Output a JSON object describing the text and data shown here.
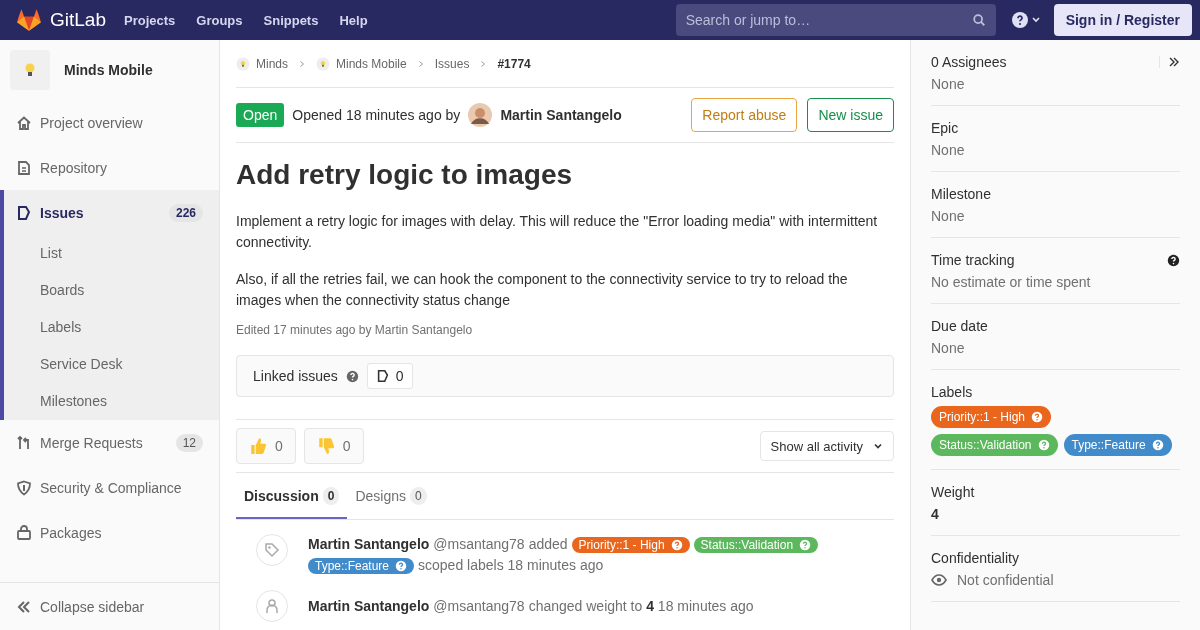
{
  "navbar": {
    "brand": "GitLab",
    "links": [
      "Projects",
      "Groups",
      "Snippets",
      "Help"
    ],
    "search": {
      "placeholder": "Search or jump to…"
    },
    "sign_in": "Sign in / Register"
  },
  "project": {
    "name": "Minds Mobile"
  },
  "nav_items": [
    {
      "label": "Project overview",
      "selected": false
    },
    {
      "label": "Repository",
      "selected": false
    },
    {
      "label": "Issues",
      "count": "226",
      "selected": true,
      "children": [
        {
          "label": "List"
        },
        {
          "label": "Boards"
        },
        {
          "label": "Labels"
        },
        {
          "label": "Service Desk"
        },
        {
          "label": "Milestones"
        }
      ]
    },
    {
      "label": "Merge Requests",
      "count": "12",
      "selected": false
    },
    {
      "label": "Security & Compliance",
      "selected": false
    },
    {
      "label": "Packages",
      "selected": false
    }
  ],
  "collapse": "Collapse sidebar",
  "breadcrumbs": [
    {
      "label": "Minds",
      "kind": "project"
    },
    {
      "label": "Minds Mobile",
      "kind": "project"
    },
    {
      "label": "Issues",
      "kind": "plain"
    },
    {
      "label": "#1774",
      "kind": "current"
    }
  ],
  "issue": {
    "status": "Open",
    "opened": "Opened 18 minutes ago by",
    "author": "Martin Santangelo",
    "actions": [
      {
        "label": "Report abuse",
        "kind": "warning"
      },
      {
        "label": "New issue",
        "kind": "success"
      }
    ],
    "title": "Add retry logic to images",
    "paragraphs": [
      "Implement a retry logic for images with delay. This will reduce the \"Error loading media\" with intermittent connectivity.",
      "Also, if all the retries fail, we can hook the component to the connectivity service to try to reload the images when the connectivity status change"
    ],
    "edited": "Edited 17 minutes ago by Martin Santangelo"
  },
  "linked_issues": {
    "label": "Linked issues",
    "count": "0"
  },
  "reactions": [
    {
      "kind": "thumbsup",
      "count": "0"
    },
    {
      "kind": "thumbsdown",
      "count": "0"
    }
  ],
  "activity_filter": "Show all activity",
  "tabs": [
    {
      "label": "Discussion",
      "count": "0",
      "selected": true
    },
    {
      "label": "Designs",
      "count": "0",
      "selected": false
    }
  ],
  "activity": [
    {
      "kind": "labels",
      "author": "Martin Santangelo",
      "handle": "@msantang78",
      "action": "added",
      "labels": [
        {
          "text": "Priority::1 - High",
          "color": "#e9661c"
        },
        {
          "text": "Status::Validation",
          "color": "#5cb85c"
        },
        {
          "text": "Type::Feature",
          "color": "#428bca"
        }
      ],
      "suffix": "scoped labels 18 minutes ago"
    },
    {
      "kind": "text",
      "author": "Martin Santangelo",
      "handle": "@msantang78",
      "action": "changed weight to **4** 18 minutes ago"
    }
  ],
  "sidebar": [
    {
      "kind": "text",
      "title": "0 Assignees",
      "value": "None"
    },
    {
      "kind": "text",
      "title": "Epic",
      "value": "None"
    },
    {
      "kind": "text",
      "title": "Milestone",
      "value": "None"
    },
    {
      "kind": "help",
      "title": "Time tracking",
      "value": "No estimate or time spent"
    },
    {
      "kind": "text",
      "title": "Due date",
      "value": "None"
    },
    {
      "kind": "labels",
      "title": "Labels",
      "labels": [
        {
          "text": "Priority::1 - High",
          "color": "#e9661c"
        },
        {
          "text": "Status::Validation",
          "color": "#5cb85c"
        },
        {
          "text": "Type::Feature",
          "color": "#428bca"
        }
      ]
    },
    {
      "kind": "bold",
      "title": "Weight",
      "value": "4"
    },
    {
      "kind": "eye",
      "title": "Confidentiality",
      "value": "Not confidential"
    }
  ]
}
